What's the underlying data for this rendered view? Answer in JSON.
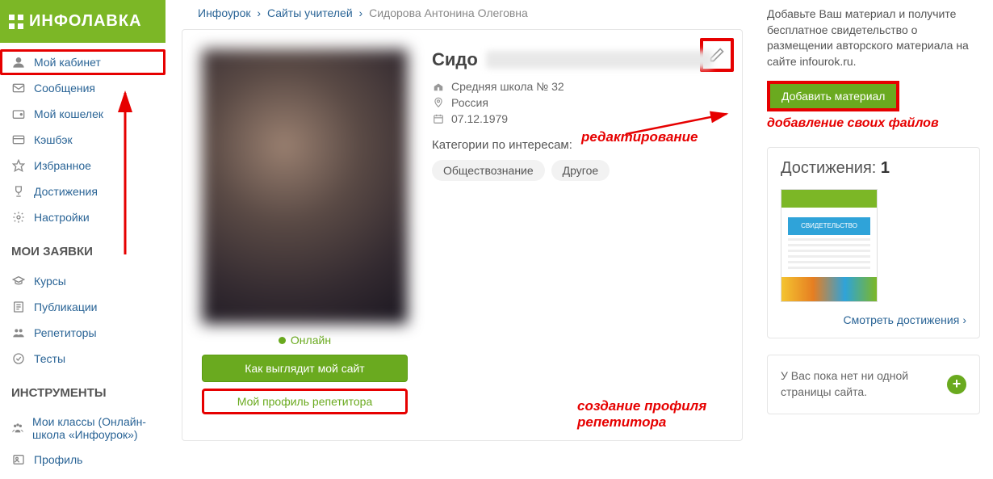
{
  "logo": "ИНФОЛАВКА",
  "breadcrumb": {
    "a": "Инфоурок",
    "b": "Сайты учителей",
    "c": "Сидорова Антонина Олеговна"
  },
  "sidebar": {
    "items": [
      {
        "label": "Мой кабинет"
      },
      {
        "label": "Сообщения"
      },
      {
        "label": "Мой кошелек"
      },
      {
        "label": "Кэшбэк"
      },
      {
        "label": "Избранное"
      },
      {
        "label": "Достижения"
      },
      {
        "label": "Настройки"
      }
    ],
    "group1_title": "МОИ ЗАЯВКИ",
    "group1": [
      {
        "label": "Курсы"
      },
      {
        "label": "Публикации"
      },
      {
        "label": "Репетиторы"
      },
      {
        "label": "Тесты"
      }
    ],
    "group2_title": "ИНСТРУМЕНТЫ",
    "group2": [
      {
        "label": "Мои классы (Онлайн-школа «Инфоурок»)"
      },
      {
        "label": "Профиль"
      }
    ]
  },
  "profile": {
    "name_visible": "Сидо",
    "online": "Онлайн",
    "btn_preview": "Как выглядит мой сайт",
    "btn_tutor": "Мой профиль репетитора",
    "school": "Средняя школа № 32",
    "country": "Россия",
    "dob": "07.12.1979",
    "cats_label": "Категории по интересам:",
    "chips": [
      "Обществознание",
      "Другое"
    ]
  },
  "annotations": {
    "edit": "редактирование",
    "tutor": "создание профиля репетитора",
    "add_files": "добавление своих файлов"
  },
  "right": {
    "promo": "Добавьте Ваш материал и получите бесплатное свидетельство о размещении авторского материала на сайте infourok.ru.",
    "add_btn": "Добавить материал",
    "ach_title": "Достижения:",
    "ach_count": "1",
    "see_ach": "Смотреть достижения",
    "no_site": "У Вас пока нет ни одной страницы сайта."
  }
}
